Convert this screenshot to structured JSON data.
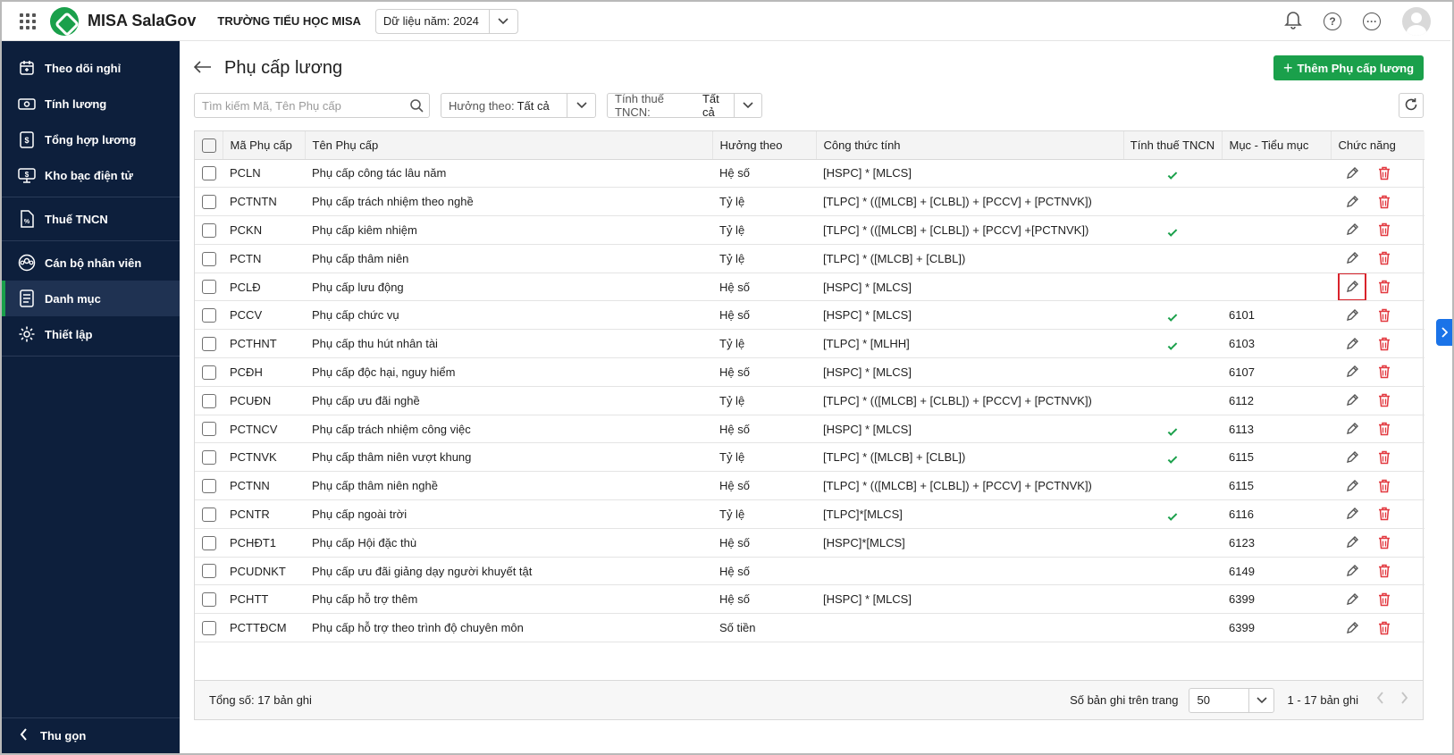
{
  "header": {
    "app_name": "MISA SalaGov",
    "school": "TRƯỜNG TIỂU HỌC MISA",
    "year_select": "Dữ liệu năm: 2024",
    "icons": [
      "apps-icon",
      "bell-icon",
      "help-icon",
      "more-icon",
      "avatar"
    ]
  },
  "sidebar": {
    "items": [
      {
        "label": "Theo dõi nghỉ",
        "icon": "calendar-icon"
      },
      {
        "label": "Tính lương",
        "icon": "money-icon"
      },
      {
        "label": "Tổng hợp lương",
        "icon": "payroll-icon"
      },
      {
        "label": "Kho bạc điện tử",
        "icon": "treasury-icon"
      },
      {
        "label": "Thuế TNCN",
        "icon": "tax-icon"
      },
      {
        "label": "Cán bộ nhân viên",
        "icon": "staff-icon"
      },
      {
        "label": "Danh mục",
        "icon": "catalog-icon"
      },
      {
        "label": "Thiết lập",
        "icon": "settings-icon"
      }
    ],
    "collapse_label": "Thu gọn"
  },
  "page": {
    "title": "Phụ cấp lương",
    "add_button": "Thêm Phụ cấp lương",
    "search_placeholder": "Tìm kiếm Mã, Tên Phụ cấp",
    "filter_huong_label": "Hưởng theo:",
    "filter_huong_value": "Tất cả",
    "filter_thue_label": "Tính thuế TNCN:",
    "filter_thue_value": "Tất cả"
  },
  "table": {
    "columns": [
      "Mã Phụ cấp",
      "Tên Phụ cấp",
      "Hưởng theo",
      "Công thức tính",
      "Tính thuế TNCN",
      "Mục - Tiểu mục",
      "Chức năng"
    ],
    "rows": [
      {
        "code": "PCLN",
        "name": "Phụ cấp công tác lâu năm",
        "type": "Hệ số",
        "formula": "[HSPC] * [MLCS]",
        "tax": true,
        "muc": ""
      },
      {
        "code": "PCTNTN",
        "name": "Phụ cấp trách nhiệm theo nghề",
        "type": "Tỷ lệ",
        "formula": "[TLPC] * (([MLCB] + [CLBL]) + [PCCV] + [PCTNVK])",
        "tax": false,
        "muc": ""
      },
      {
        "code": "PCKN",
        "name": "Phụ cấp kiêm nhiệm",
        "type": "Tỷ lệ",
        "formula": "[TLPC] * (([MLCB] + [CLBL]) + [PCCV] +[PCTNVK])",
        "tax": true,
        "muc": ""
      },
      {
        "code": "PCTN",
        "name": "Phụ cấp thâm niên",
        "type": "Tỷ lệ",
        "formula": "[TLPC] * ([MLCB] + [CLBL])",
        "tax": false,
        "muc": ""
      },
      {
        "code": "PCLĐ",
        "name": "Phụ cấp lưu động",
        "type": "Hệ số",
        "formula": "[HSPC] * [MLCS]",
        "tax": false,
        "muc": "",
        "highlight": true
      },
      {
        "code": "PCCV",
        "name": "Phụ cấp chức vụ",
        "type": "Hệ số",
        "formula": "[HSPC] * [MLCS]",
        "tax": true,
        "muc": "6101"
      },
      {
        "code": "PCTHNT",
        "name": "Phụ cấp thu hút nhân tài",
        "type": "Tỷ lệ",
        "formula": "[TLPC] * [MLHH]",
        "tax": true,
        "muc": "6103"
      },
      {
        "code": "PCĐH",
        "name": "Phụ cấp độc hại, nguy hiểm",
        "type": "Hệ số",
        "formula": "[HSPC] * [MLCS]",
        "tax": false,
        "muc": "6107"
      },
      {
        "code": "PCUĐN",
        "name": "Phụ cấp ưu đãi nghề",
        "type": "Tỷ lệ",
        "formula": "[TLPC] * (([MLCB] + [CLBL]) + [PCCV] + [PCTNVK])",
        "tax": false,
        "muc": "6112"
      },
      {
        "code": "PCTNCV",
        "name": "Phụ cấp trách nhiệm công việc",
        "type": "Hệ số",
        "formula": "[HSPC] * [MLCS]",
        "tax": true,
        "muc": "6113"
      },
      {
        "code": "PCTNVK",
        "name": "Phụ cấp thâm niên vượt khung",
        "type": "Tỷ lệ",
        "formula": "[TLPC] * ([MLCB] + [CLBL])",
        "tax": true,
        "muc": "6115"
      },
      {
        "code": "PCTNN",
        "name": "Phụ cấp thâm niên nghề",
        "type": "Hệ số",
        "formula": "[TLPC] * (([MLCB] + [CLBL]) + [PCCV] + [PCTNVK])",
        "tax": false,
        "muc": "6115"
      },
      {
        "code": "PCNTR",
        "name": "Phụ cấp ngoài trời",
        "type": "Tỷ lệ",
        "formula": "[TLPC]*[MLCS]",
        "tax": true,
        "muc": "6116"
      },
      {
        "code": "PCHĐT1",
        "name": "Phụ cấp Hội đặc thù",
        "type": "Hệ số",
        "formula": "[HSPC]*[MLCS]",
        "tax": false,
        "muc": "6123"
      },
      {
        "code": "PCUDNKT",
        "name": "Phụ cấp ưu đãi giảng dạy người khuyết tật",
        "type": "Hệ số",
        "formula": "",
        "tax": false,
        "muc": "6149"
      },
      {
        "code": "PCHTT",
        "name": "Phụ cấp hỗ trợ thêm",
        "type": "Hệ số",
        "formula": "[HSPC] * [MLCS]",
        "tax": false,
        "muc": "6399"
      },
      {
        "code": "PCTTĐCM",
        "name": "Phụ cấp hỗ trợ theo trình độ chuyên môn",
        "type": "Số tiền",
        "formula": "",
        "tax": false,
        "muc": "6399"
      }
    ]
  },
  "footer": {
    "total": "Tổng số: 17 bản ghi",
    "page_size_label": "Số bản ghi trên trang",
    "page_size": "50",
    "range": "1 - 17 bản ghi"
  }
}
